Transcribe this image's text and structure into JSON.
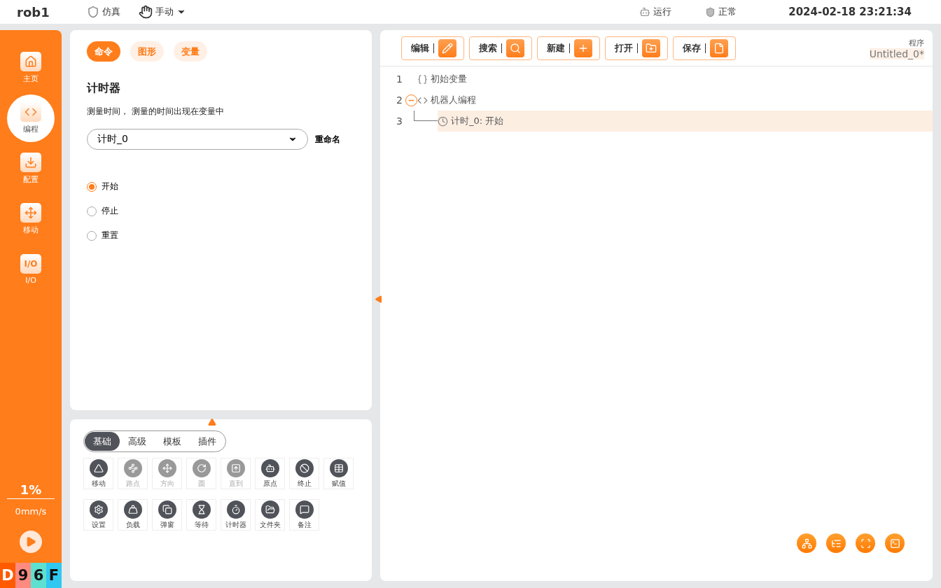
{
  "header": {
    "robot": "rob1",
    "mode": "仿真",
    "control": "手动",
    "run": "运行",
    "status": "正常",
    "datetime": "2024-02-18 23:21:34"
  },
  "nav": [
    {
      "label": "主页",
      "selected": false
    },
    {
      "label": "编程",
      "selected": true
    },
    {
      "label": "配置",
      "selected": false
    },
    {
      "label": "移动",
      "selected": false
    },
    {
      "label": "I/O",
      "selected": false,
      "icon_text": "I/O"
    }
  ],
  "speed": {
    "percent": "1%",
    "velocity": "0mm/s"
  },
  "badges": [
    {
      "label": "D",
      "color": "#ff5a00"
    },
    {
      "label": "9",
      "color": "#ff8a80"
    },
    {
      "label": "6",
      "color": "#5ee0d0"
    },
    {
      "label": "F",
      "color": "#30c8f0"
    }
  ],
  "panel_tabs": [
    {
      "label": "命令",
      "selected": true
    },
    {
      "label": "图形",
      "selected": false
    },
    {
      "label": "变量",
      "selected": false
    }
  ],
  "command": {
    "title": "计时器",
    "description": "测量时间， 测量的时间出现在变量中",
    "select_value": "计时_0",
    "rename": "重命名",
    "options": [
      {
        "label": "开始",
        "selected": true
      },
      {
        "label": "停止",
        "selected": false
      },
      {
        "label": "重置",
        "selected": false
      }
    ]
  },
  "palette_tabs": [
    {
      "label": "基础",
      "selected": true
    },
    {
      "label": "高级",
      "selected": false
    },
    {
      "label": "模板",
      "selected": false
    },
    {
      "label": "插件",
      "selected": false
    }
  ],
  "palette": [
    {
      "label": "移动",
      "disabled": false
    },
    {
      "label": "路点",
      "disabled": true
    },
    {
      "label": "方向",
      "disabled": true
    },
    {
      "label": "圆",
      "disabled": true
    },
    {
      "label": "直到",
      "disabled": true
    },
    {
      "label": "原点",
      "disabled": false
    },
    {
      "label": "终止",
      "disabled": false
    },
    {
      "label": "赋值",
      "disabled": false
    },
    {
      "label": "设置",
      "disabled": false
    },
    {
      "label": "负载",
      "disabled": false
    },
    {
      "label": "弹窗",
      "disabled": false
    },
    {
      "label": "等待",
      "disabled": false
    },
    {
      "label": "计时器",
      "disabled": false
    },
    {
      "label": "文件夹",
      "disabled": false
    },
    {
      "label": "备注",
      "disabled": false
    }
  ],
  "toolbar": [
    "编辑",
    "搜索",
    "新建",
    "打开",
    "保存"
  ],
  "program": {
    "label": "程序",
    "name": "Untitled_0*"
  },
  "tree": [
    {
      "line": "1",
      "text": "初始变量",
      "selected": false
    },
    {
      "line": "2",
      "text": "机器人编程",
      "selected": false,
      "expanded": true,
      "children": [
        {
          "line": "3",
          "text": "计时_0: 开始",
          "selected": true
        }
      ]
    }
  ]
}
